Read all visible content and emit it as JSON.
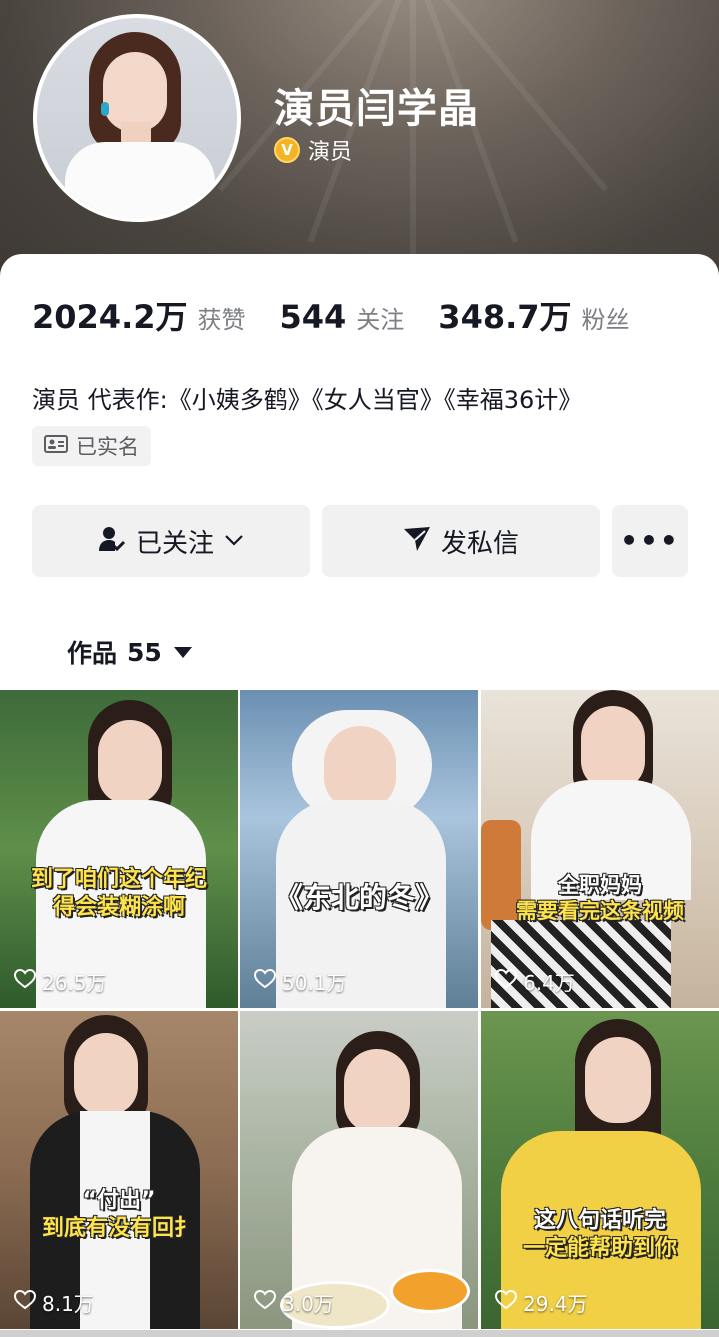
{
  "profile": {
    "name": "演员闫学晶",
    "verify_badge": "V",
    "verify_text": "演员"
  },
  "stats": [
    {
      "value": "2024.2万",
      "label": "获赞"
    },
    {
      "value": "544",
      "label": "关注"
    },
    {
      "value": "348.7万",
      "label": "粉丝"
    }
  ],
  "bio": "演员 代表作:《小姨多鹤》《女人当官》《幸福36计》",
  "realname_badge": "已实名",
  "actions": {
    "follow": "已关注",
    "message": "发私信",
    "more": "•••"
  },
  "works": {
    "label": "作品",
    "count": "55"
  },
  "videos": [
    {
      "caption": [
        "到了咱们这个年纪",
        "得会装糊涂啊"
      ],
      "likes": "26.5万"
    },
    {
      "caption": [
        "《东北的冬》"
      ],
      "likes": "50.1万"
    },
    {
      "caption": [
        "全职妈妈",
        "需要看完这条视频"
      ],
      "likes": "6.4万"
    },
    {
      "caption": [
        "“付出”",
        "到底有没有回扌"
      ],
      "likes": "8.1万"
    },
    {
      "caption": [],
      "likes": "3.0万"
    },
    {
      "caption": [
        "这八句话听完",
        "一定能帮助到你"
      ],
      "likes": "29.4万"
    }
  ],
  "colors": {
    "caption_yellow": "#ffe34d",
    "verify_gold": "#f5b423",
    "button_bg": "#f1f1f2"
  }
}
